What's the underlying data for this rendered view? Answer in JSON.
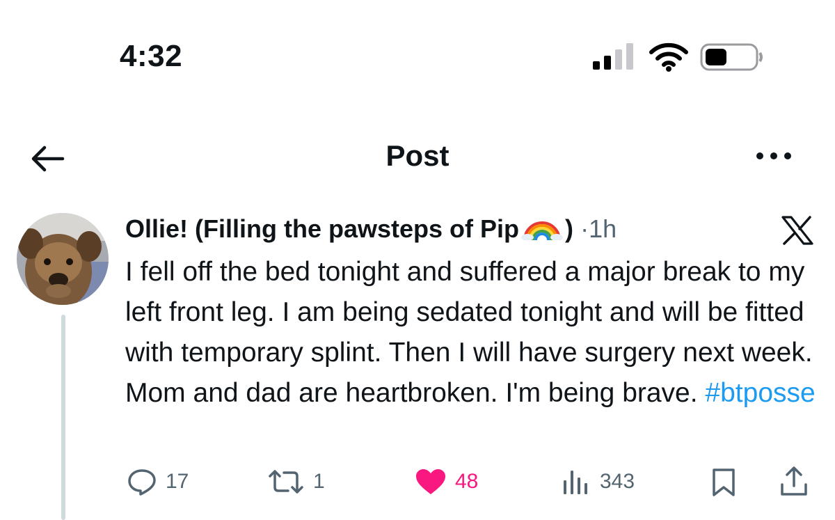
{
  "status_bar": {
    "time": "4:32"
  },
  "header": {
    "title": "Post"
  },
  "post": {
    "display_name": "Ollie! (Filling the pawsteps of Pip",
    "display_name_suffix": ")",
    "separator": "·",
    "time_ago": "1h",
    "text": "I fell off the bed tonight and suffered a major break to my left front leg. I am being sedated tonight and will be fitted with temporary splint. Then I will have surgery next week.  Mom and dad are heartbroken.  I'm being brave. ",
    "hashtag": "#btposse"
  },
  "actions": {
    "replies": "17",
    "reposts": "1",
    "likes": "48",
    "views": "343"
  },
  "colors": {
    "text": "#0f1419",
    "muted": "#536471",
    "link": "#1d9bf0",
    "like": "#f91880"
  }
}
